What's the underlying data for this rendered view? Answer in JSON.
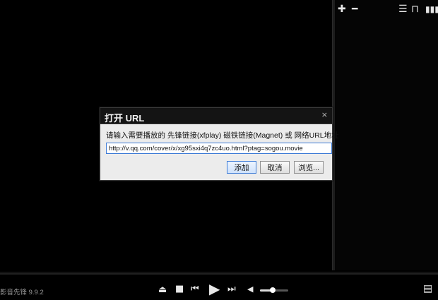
{
  "player": {
    "app_name": "影音先锋 9.9.2",
    "volume_fraction": 0.45
  },
  "playlist": {
    "toolbar_icons": [
      "add-icon",
      "remove-icon",
      "menu-icon",
      "pin-icon",
      "signal-icon"
    ]
  },
  "controls": {
    "icons": [
      "eject-icon",
      "stop-icon",
      "previous-icon",
      "play-icon",
      "next-icon",
      "volume-icon",
      "playlist-toggle-icon"
    ]
  },
  "dialog": {
    "title": "打开 URL",
    "close_glyph": "×",
    "prompt": "请输入需要播放的 先锋链接(xfplay) 磁铁链接(Magnet) 或 网络URL地址",
    "url_value": "http://v.qq.com/cover/x/xg95sxi4q7zc4uo.html?ptag=sogou.movie",
    "buttons": {
      "add": "添加",
      "cancel": "取消",
      "browse": "浏览..."
    }
  },
  "colors": {
    "background": "#000000",
    "dialog_bg": "#ececec",
    "input_border": "#3d7bd6"
  }
}
